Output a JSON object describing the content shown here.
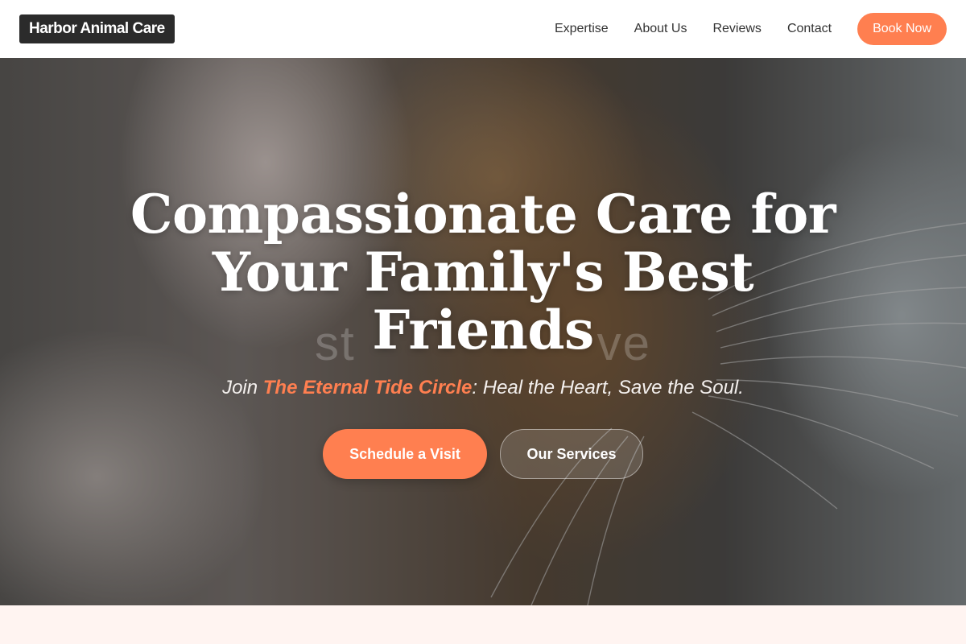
{
  "header": {
    "logo": "Harbor Animal Care",
    "nav": [
      "Expertise",
      "About Us",
      "Reviews",
      "Contact"
    ],
    "book_label": "Book Now"
  },
  "hero": {
    "headline": "Compassionate Care for Your Family's Best Friends",
    "ghost_left": "st",
    "ghost_right": "ve",
    "tagline_prefix": "Join ",
    "tagline_accent": "The Eternal Tide Circle",
    "tagline_suffix": ": Heal the Heart, Save the Soul.",
    "primary_cta": "Schedule a Visit",
    "secondary_cta": "Our Services"
  },
  "colors": {
    "accent": "#ff7f50",
    "logo_bg": "#2b2b2b",
    "section_bg": "#fff4f1"
  }
}
